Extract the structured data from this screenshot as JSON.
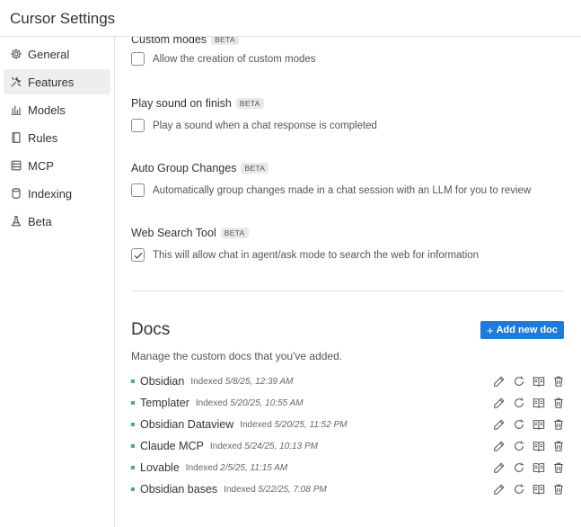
{
  "window": {
    "title": "Cursor Settings"
  },
  "sidebar": {
    "items": [
      {
        "label": "General",
        "icon": "gear-icon"
      },
      {
        "label": "Features",
        "icon": "tools-icon",
        "active": true
      },
      {
        "label": "Models",
        "icon": "bar-chart-icon"
      },
      {
        "label": "Rules",
        "icon": "document-icon"
      },
      {
        "label": "MCP",
        "icon": "server-icon"
      },
      {
        "label": "Indexing",
        "icon": "database-icon"
      },
      {
        "label": "Beta",
        "icon": "flask-icon"
      }
    ]
  },
  "features": {
    "settings": [
      {
        "name": "Custom modes",
        "badge": "BETA",
        "description": "Allow the creation of custom modes",
        "checked": false
      },
      {
        "name": "Play sound on finish",
        "badge": "BETA",
        "description": "Play a sound when a chat response is completed",
        "checked": false
      },
      {
        "name": "Auto Group Changes",
        "badge": "BETA",
        "description": "Automatically group changes made in a chat session with an LLM for you to review",
        "checked": false
      },
      {
        "name": "Web Search Tool",
        "badge": "BETA",
        "description": "This will allow chat in agent/ask mode to search the web for information",
        "checked": true
      }
    ]
  },
  "docs": {
    "title": "Docs",
    "add_button": "Add new doc",
    "description": "Manage the custom docs that you've added.",
    "indexed_label": "Indexed",
    "items": [
      {
        "name": "Obsidian",
        "indexed": "5/8/25, 12:39 AM"
      },
      {
        "name": "Templater",
        "indexed": "5/20/25, 10:55 AM"
      },
      {
        "name": "Obsidian Dataview",
        "indexed": "5/20/25, 11:52 PM"
      },
      {
        "name": "Claude MCP",
        "indexed": "5/24/25, 10:13 PM"
      },
      {
        "name": "Lovable",
        "indexed": "2/5/25, 11:15 AM"
      },
      {
        "name": "Obsidian bases",
        "indexed": "5/22/25, 7:08 PM"
      }
    ]
  }
}
